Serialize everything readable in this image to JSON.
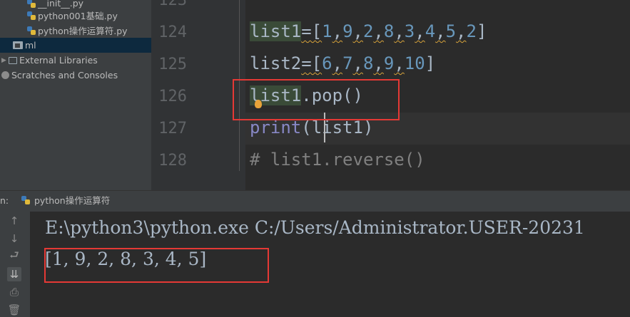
{
  "project_tree": {
    "items": [
      {
        "label": "__init__.py",
        "icon": "python-file-icon"
      },
      {
        "label": "python001基础.py",
        "icon": "python-file-icon"
      },
      {
        "label": "python操作运算符.py",
        "icon": "python-file-icon"
      },
      {
        "label": "ml",
        "icon": "folder-icon"
      },
      {
        "label": "External Libraries",
        "icon": "library-icon"
      },
      {
        "label": "Scratches and Consoles",
        "icon": "scratches-icon"
      }
    ]
  },
  "editor": {
    "line_numbers": [
      "124",
      "125",
      "126",
      "127",
      "128"
    ],
    "lines": {
      "l124": {
        "var": "list1",
        "op": "=[",
        "nums": [
          "1",
          "9",
          "2",
          "8",
          "3",
          "4",
          "5",
          "2"
        ],
        "close": "]"
      },
      "l125": {
        "var": "list2",
        "op": "=[",
        "nums": [
          "6",
          "7",
          "8",
          "9",
          "10"
        ],
        "close": "]"
      },
      "l126": {
        "var": "list1",
        "rest": ".pop()"
      },
      "l127": {
        "builtin": "print",
        "open": "(",
        "arg": "list1",
        "close": ")"
      },
      "l128": {
        "comment": "# list1.reverse()"
      }
    },
    "top_partial_line_number": "123"
  },
  "run_panel": {
    "label": "n:",
    "tab": "python操作运算符",
    "output": {
      "command": "E:\\python3\\python.exe C:/Users/Administrator.USER-20231",
      "result": "[1, 9, 2, 8, 3, 4, 5]"
    }
  },
  "colors": {
    "background": "#2b2b2b",
    "highlight_box": "#e53935",
    "number": "#6897bb",
    "builtin": "#8888c6",
    "comment": "#808080"
  }
}
